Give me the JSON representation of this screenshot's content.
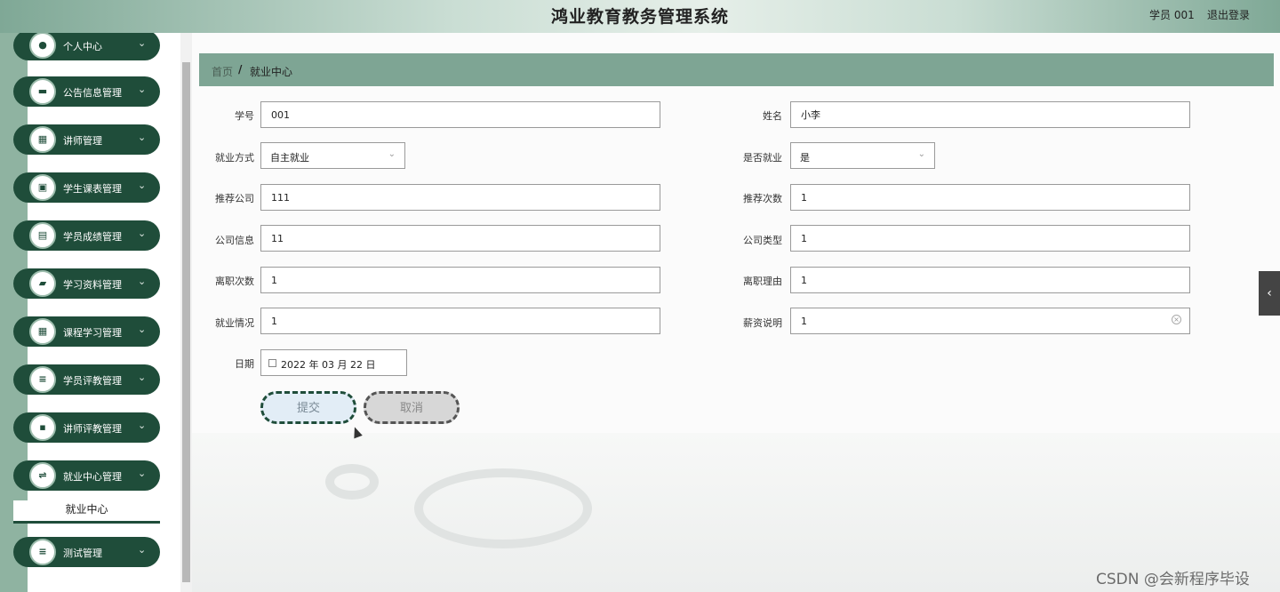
{
  "header": {
    "title": "鸿业教育教务管理系统",
    "user_label": "学员 001",
    "logout_label": "退出登录"
  },
  "sidebar": {
    "items": [
      {
        "label": "个人中心",
        "icon": "person-icon",
        "glyph": "●"
      },
      {
        "label": "公告信息管理",
        "icon": "notice-icon",
        "glyph": "▬"
      },
      {
        "label": "讲师管理",
        "icon": "grid-icon",
        "glyph": "▦"
      },
      {
        "label": "学生课表管理",
        "icon": "briefcase-icon",
        "glyph": "▣"
      },
      {
        "label": "学员成绩管理",
        "icon": "chat-icon",
        "glyph": "▤"
      },
      {
        "label": "学习资料管理",
        "icon": "ticket-icon",
        "glyph": "▰"
      },
      {
        "label": "课程学习管理",
        "icon": "grid-icon",
        "glyph": "▦"
      },
      {
        "label": "学员评教管理",
        "icon": "list-icon",
        "glyph": "≡"
      },
      {
        "label": "讲师评教管理",
        "icon": "clipboard-icon",
        "glyph": "▪"
      },
      {
        "label": "就业中心管理",
        "icon": "sliders-icon",
        "glyph": "⇌"
      },
      {
        "label": "测试管理",
        "icon": "menu-icon",
        "glyph": "≡"
      }
    ],
    "sub_item": "就业中心",
    "chevron": "⌄"
  },
  "breadcrumb": {
    "home": "首页",
    "separator": "/",
    "current": "就业中心"
  },
  "form": {
    "student_id": {
      "label": "学号",
      "value": "001"
    },
    "name": {
      "label": "姓名",
      "value": "小李"
    },
    "employment_method": {
      "label": "就业方式",
      "value": "自主就业"
    },
    "employed": {
      "label": "是否就业",
      "value": "是"
    },
    "recommended_company": {
      "label": "推荐公司",
      "value": "111"
    },
    "recommend_count": {
      "label": "推荐次数",
      "value": "1"
    },
    "company_info": {
      "label": "公司信息",
      "value": "11"
    },
    "company_type": {
      "label": "公司类型",
      "value": "1"
    },
    "resign_count": {
      "label": "离职次数",
      "value": "1"
    },
    "resign_reason": {
      "label": "离职理由",
      "value": "1"
    },
    "employment_status": {
      "label": "就业情况",
      "value": "1"
    },
    "salary_note": {
      "label": "薪资说明",
      "value": "1"
    },
    "date": {
      "label": "日期",
      "value": "2022 年 03 月 22 日"
    }
  },
  "buttons": {
    "submit": "提交",
    "cancel": "取消"
  },
  "watermark": "CSDN @会新程序毕设",
  "colors": {
    "sidebar_green": "#1f4d3a",
    "breadcrumb_bar": "#7ea594"
  }
}
